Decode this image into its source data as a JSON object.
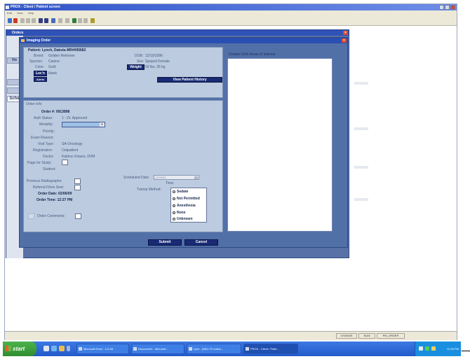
{
  "app": {
    "title": "PROX - Client / Patient screen",
    "menu": [
      "Edit",
      "View",
      "Help"
    ]
  },
  "orders": {
    "title": "Orders",
    "close": "×",
    "side_items": [
      "Vie",
      "Sche"
    ]
  },
  "imaging": {
    "title": "Imaging Order",
    "close": "×",
    "patient": {
      "name_line": "Patient: Lynch, Dakota MR#095682",
      "breed_label": "Breed:",
      "breed": "Golden Retriever",
      "species_label": "Species:",
      "species": "Canine",
      "color_label": "Color:",
      "color": "Gold",
      "lecn_label": "Lec'n",
      "lecn_value": "blank",
      "alerts_label": "Alerts",
      "dob_label": "DOB:",
      "dob": "12/19/1996",
      "sex_label": "Sex:",
      "sex": "Spayed Female",
      "weight_label": "Weight",
      "weight": "59 lbs, 26 kg",
      "history_button": "View Patient History"
    },
    "order": {
      "section": "Order Info",
      "order_no": "Order #: 0913898",
      "auth_label": "Auth Status:",
      "auth": "1 - Dr. Approved",
      "modality_label": "Modality:",
      "priority_label": "Priority:",
      "exam_reason_label": "Exam Reason:",
      "visit_type_label": "Visit Type:",
      "visit_type": "SA-Oncology",
      "registration_label": "Registration:",
      "registration": "Outpatient",
      "doctor_label": "Doctor:",
      "doctor": "Katrina Viviano, DVM",
      "page_study_label": "Page for Study:",
      "student_label": "Student:",
      "prev_radiographs_label": "Previous Radiographs:",
      "referral_films_label": "Referral Films Sent:",
      "order_date": "Order Date: 02/06/09",
      "order_time": "Order Time: 12:27 PM",
      "order_comments_label": "Order Comments:",
      "scheduled_date_label": "Scheduled Date:",
      "scheduled_date_value": "12/00/00",
      "time_label": "Time:",
      "transport_label": "Transp Method:",
      "transport_options": [
        "Sedate",
        "Not Permitted",
        "Anesthesia",
        "None",
        "Unknown"
      ]
    },
    "interest_label": "Double-Click Areas of Interest",
    "submit": "Submit",
    "cancel": "Cancel"
  },
  "statusbar": [
    "CHANGE",
    "NUM",
    "PM_ORDER"
  ],
  "taskbar": {
    "start": "start",
    "tasks": [
      "Microsoft Excel - 2-6-09",
      "Document1 - Microsof...",
      "Lynx - (MD)-TS online...",
      "PROX - Client / Patie..."
    ],
    "clock": "12:28 PM"
  },
  "colors": {
    "window_bg": "#5270a8",
    "panel": "#bccbdf",
    "navy_button": "#1a2b75",
    "title_bar": "#2a4fb3"
  }
}
